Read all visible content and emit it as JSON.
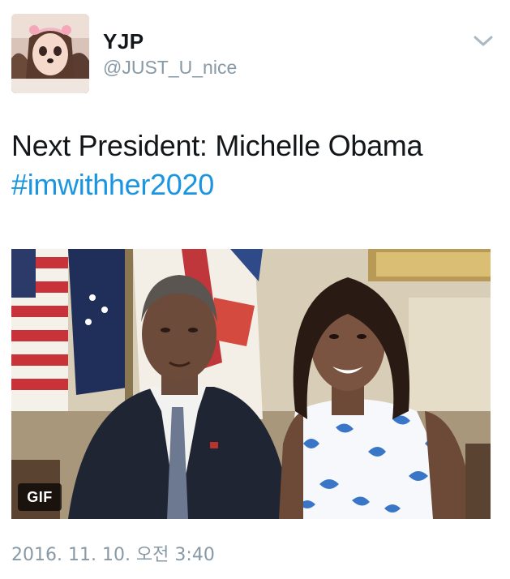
{
  "user": {
    "display_name": "YJP",
    "handle": "@JUST_U_nice",
    "avatar_icon": "profile-photo"
  },
  "tweet": {
    "text": "Next President: Michelle Obama",
    "hashtag": "#imwithher2020",
    "media_badge": "GIF",
    "timestamp": "2016. 11. 10. 오전 3:40"
  },
  "menu": {
    "icon": "chevron-down-icon"
  },
  "colors": {
    "link": "#1b95e0",
    "secondary_text": "#8899a6",
    "primary_text": "#14171a"
  }
}
